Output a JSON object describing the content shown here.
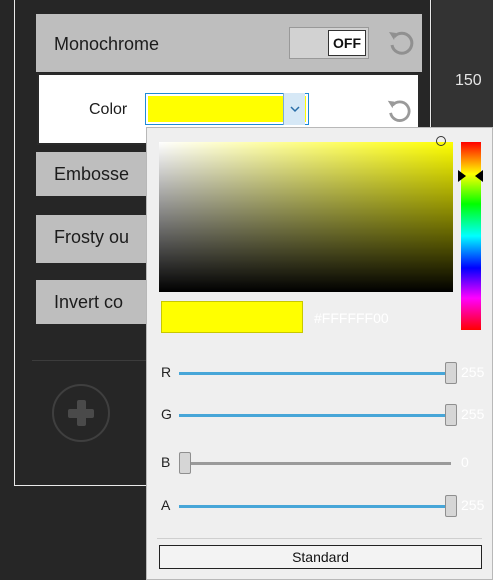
{
  "effects": {
    "monochrome": {
      "label": "Monochrome",
      "toggle_state": "OFF"
    },
    "color_setting": {
      "label": "Color",
      "value_color": "#ffff00"
    },
    "emboss": {
      "label": "Embosse"
    },
    "frosty": {
      "label": "Frosty ou"
    },
    "invert": {
      "label": "Invert co"
    }
  },
  "right_panel": {
    "number": "150"
  },
  "color_picker": {
    "hex": "#FFFFFF00",
    "selected_color": "#ffff00",
    "channels": [
      {
        "name": "R",
        "value": "255",
        "fraction": 1.0
      },
      {
        "name": "G",
        "value": "255",
        "fraction": 1.0
      },
      {
        "name": "B",
        "value": "0",
        "fraction": 0.0
      },
      {
        "name": "A",
        "value": "255",
        "fraction": 1.0
      }
    ],
    "standard_label": "Standard"
  },
  "icons": {
    "reset": "reset-icon",
    "add": "add-icon",
    "dropdown": "chevron-down-icon"
  }
}
